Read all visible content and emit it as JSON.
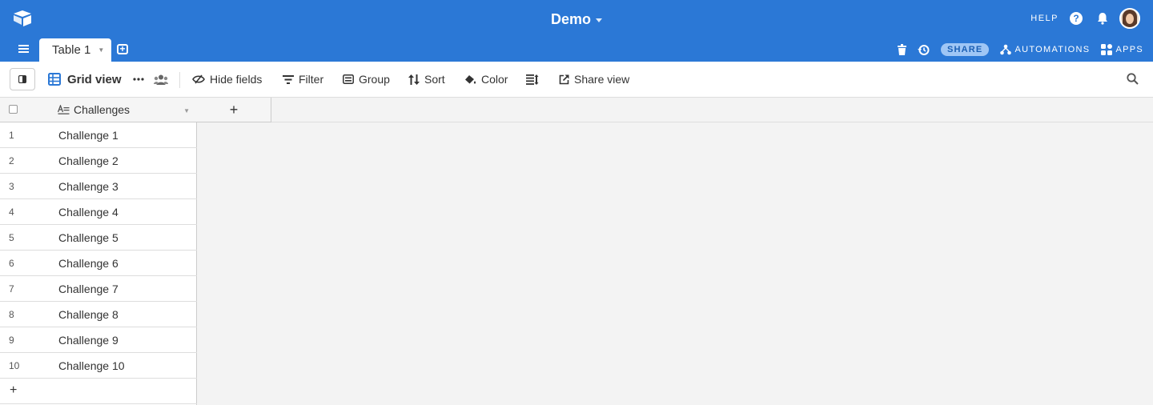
{
  "app": {
    "base_title": "Demo"
  },
  "topbar": {
    "help_label": "HELP",
    "help_icon": "question-circle-icon",
    "bell_icon": "bell-icon"
  },
  "tabs": [
    {
      "label": "Table 1",
      "active": true
    }
  ],
  "tabs_right": {
    "trash_icon": "trash-icon",
    "history_icon": "history-icon",
    "share_label": "SHARE",
    "automations_label": "AUTOMATIONS",
    "apps_label": "APPS"
  },
  "viewbar": {
    "view_name": "Grid view",
    "hide_fields": "Hide fields",
    "filter": "Filter",
    "group": "Group",
    "sort": "Sort",
    "color": "Color",
    "share_view": "Share view"
  },
  "grid": {
    "column_header": "Challenges",
    "rows": [
      {
        "num": "1",
        "value": "Challenge 1"
      },
      {
        "num": "2",
        "value": "Challenge 2"
      },
      {
        "num": "3",
        "value": "Challenge 3"
      },
      {
        "num": "4",
        "value": "Challenge 4"
      },
      {
        "num": "5",
        "value": "Challenge 5"
      },
      {
        "num": "6",
        "value": "Challenge 6"
      },
      {
        "num": "7",
        "value": "Challenge 7"
      },
      {
        "num": "8",
        "value": "Challenge 8"
      },
      {
        "num": "9",
        "value": "Challenge 9"
      },
      {
        "num": "10",
        "value": "Challenge 10"
      }
    ],
    "add_row": "+",
    "add_field": "+"
  },
  "colors": {
    "brand": "#2b78d6",
    "share_pill": "#9fc6f5"
  }
}
